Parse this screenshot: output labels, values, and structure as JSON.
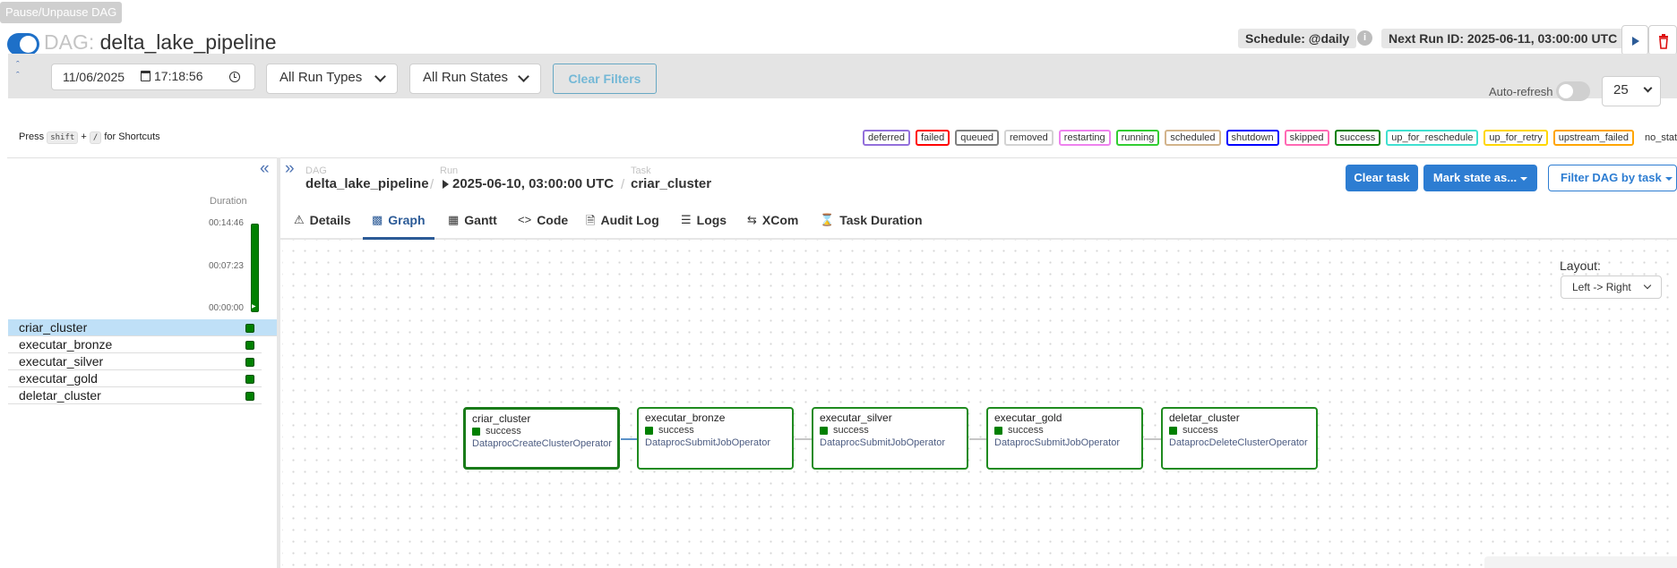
{
  "header": {
    "tooltip": "Pause/Unpause DAG",
    "dag_label": "DAG:",
    "dag_id": "delta_lake_pipeline",
    "schedule": "Schedule: @daily",
    "info_icon": "i",
    "next_run": "Next Run ID: 2025-06-11, 03:00:00 UTC",
    "actions": {
      "trigger_icon": "play-icon",
      "delete_icon": "trash-icon"
    }
  },
  "filters": {
    "date": "11/06/2025",
    "time": "17:18:56",
    "run_types": "All Run Types",
    "run_states": "All Run States",
    "clear_label": "Clear Filters",
    "auto_refresh_label": "Auto-refresh",
    "page_size": "25"
  },
  "shortcuts": {
    "prefix": "Press",
    "key1": "shift",
    "plus": "+",
    "key2": "/",
    "suffix": "for Shortcuts"
  },
  "legend": [
    {
      "label": "deferred",
      "color": "#9370db"
    },
    {
      "label": "failed",
      "color": "#ff0000"
    },
    {
      "label": "queued",
      "color": "#808080"
    },
    {
      "label": "removed",
      "color": "#d3d3d3"
    },
    {
      "label": "restarting",
      "color": "#ee82ee"
    },
    {
      "label": "running",
      "color": "#32cd32"
    },
    {
      "label": "scheduled",
      "color": "#d2b48c"
    },
    {
      "label": "shutdown",
      "color": "#0000ff"
    },
    {
      "label": "skipped",
      "color": "#ff69b4"
    },
    {
      "label": "success",
      "color": "#008000"
    },
    {
      "label": "up_for_reschedule",
      "color": "#40e0d0"
    },
    {
      "label": "up_for_retry",
      "color": "#ffd700"
    },
    {
      "label": "upstream_failed",
      "color": "#ffa500"
    },
    {
      "label": "no_status",
      "color": ""
    }
  ],
  "grid": {
    "duration_label": "Duration",
    "ticks": [
      "00:14:46",
      "00:07:23",
      "00:00:00"
    ],
    "tasks": [
      {
        "name": "criar_cluster",
        "state": "success"
      },
      {
        "name": "executar_bronze",
        "state": "success"
      },
      {
        "name": "executar_silver",
        "state": "success"
      },
      {
        "name": "executar_gold",
        "state": "success"
      },
      {
        "name": "deletar_cluster",
        "state": "success"
      }
    ]
  },
  "breadcrumb": {
    "dag_label": "DAG",
    "dag_value": "delta_lake_pipeline",
    "run_label": "Run",
    "run_value": "2025-06-10, 03:00:00 UTC",
    "task_label": "Task",
    "task_value": "criar_cluster",
    "sep": "/"
  },
  "task_actions": {
    "clear_task": "Clear task",
    "mark_state": "Mark state as...",
    "filter_dag": "Filter DAG by task"
  },
  "tabs": [
    {
      "label": "Details",
      "icon": "warning-icon"
    },
    {
      "label": "Graph",
      "icon": "graph-icon"
    },
    {
      "label": "Gantt",
      "icon": "gantt-icon"
    },
    {
      "label": "Code",
      "icon": "code-icon"
    },
    {
      "label": "Audit Log",
      "icon": "audit-icon"
    },
    {
      "label": "Logs",
      "icon": "logs-icon"
    },
    {
      "label": "XCom",
      "icon": "xcom-icon"
    },
    {
      "label": "Task Duration",
      "icon": "hourglass-icon"
    }
  ],
  "graph": {
    "layout_label": "Layout:",
    "layout_value": "Left -> Right",
    "nodes": [
      {
        "name": "criar_cluster",
        "state": "success",
        "operator": "DataprocCreateClusterOperator"
      },
      {
        "name": "executar_bronze",
        "state": "success",
        "operator": "DataprocSubmitJobOperator"
      },
      {
        "name": "executar_silver",
        "state": "success",
        "operator": "DataprocSubmitJobOperator"
      },
      {
        "name": "executar_gold",
        "state": "success",
        "operator": "DataprocSubmitJobOperator"
      },
      {
        "name": "deletar_cluster",
        "state": "success",
        "operator": "DataprocDeleteClusterOperator"
      }
    ]
  }
}
